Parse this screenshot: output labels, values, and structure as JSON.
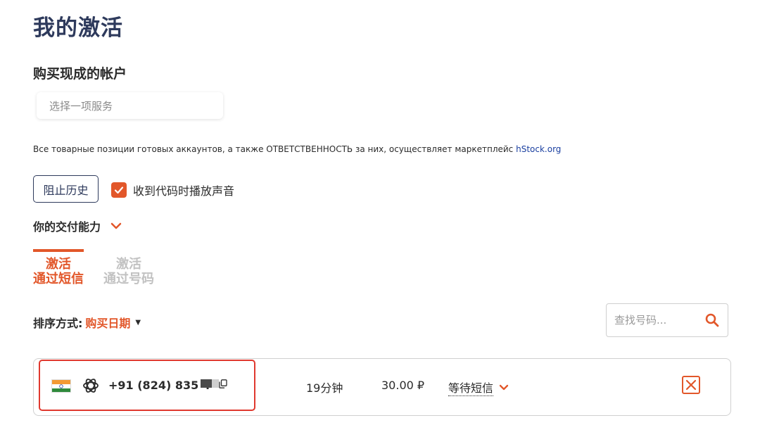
{
  "header": {
    "title": "我的激活"
  },
  "buy_section": {
    "title": "购买现成的帐户",
    "service_placeholder": "选择一项服务",
    "notice_text": "Все товарные позиции готовых аккаунтов, а также ОТВЕТСТВЕННОСТЬ за них, осуществляет маркетплейс ",
    "notice_link": "hStock.org"
  },
  "controls": {
    "history_button": "阻止历史",
    "sound_label": "收到代码时播放声音",
    "sound_checked": true,
    "capacity_label": "你的交付能力"
  },
  "tabs": [
    {
      "line1": "激活",
      "line2": "通过短信",
      "active": true
    },
    {
      "line1": "激活",
      "line2": "通过号码",
      "active": false
    }
  ],
  "sort": {
    "label": "排序方式:",
    "value": "购买日期"
  },
  "search": {
    "placeholder": "查找号码..."
  },
  "activations": [
    {
      "country": "India",
      "service_icon": "openai-icon",
      "phone": "+91 (824) 835 4",
      "time": "19分钟",
      "price": "30.00 ₽",
      "status": "等待短信"
    }
  ],
  "colors": {
    "accent": "#e2572a",
    "title": "#2e3a5c",
    "highlight": "#e0382e",
    "link": "#1a3fa0"
  }
}
